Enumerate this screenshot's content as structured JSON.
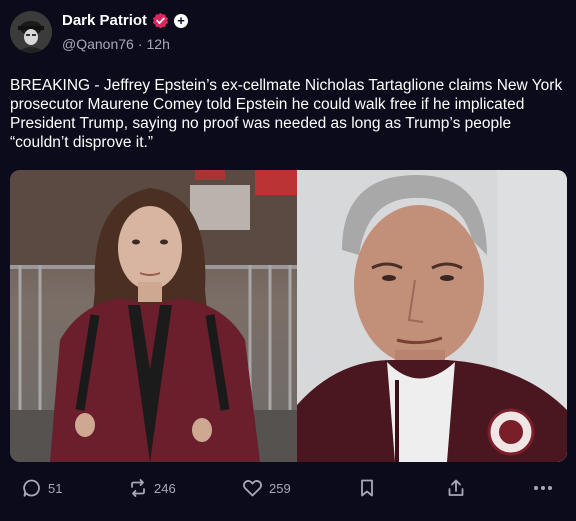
{
  "post": {
    "author_name": "Dark Patriot",
    "handle": "@Qanon76",
    "separator": "·",
    "time": "12h",
    "body": "BREAKING - Jeffrey Epstein’s ex-cellmate Nicholas Tartaglione claims New York prosecutor Maurene Comey told Epstein he could walk free if he implicated President Trump, saying no proof was needed as long as Trump’s people “couldn’t disprove it.”",
    "images": [
      {
        "icon": "photo-woman-maroon-coat"
      },
      {
        "icon": "photo-man-maroon-sweater"
      }
    ]
  },
  "actions": {
    "replies": "51",
    "reposts": "246",
    "likes": "259"
  },
  "colors": {
    "background": "#0b0b1c",
    "muted_text": "#a8a8b8",
    "verified_badge": "#e0245e"
  }
}
